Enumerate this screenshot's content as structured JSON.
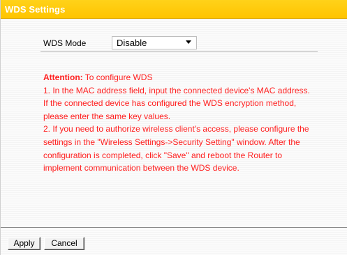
{
  "header": {
    "title": "WDS Settings"
  },
  "wds_mode": {
    "label": "WDS Mode",
    "selected": "Disable"
  },
  "attention": {
    "heading": "Attention:",
    "heading_rest": " To configure WDS",
    "lines": [
      "1. In the MAC address field, input the connected device's MAC address.",
      "If the connected device has configured the WDS encryption method,",
      "please enter the same key values.",
      "2. If you need to authorize wireless client's access, please configure the",
      "settings in the \"Wireless Settings->Security Setting\" window. After the",
      "configuration is completed, click \"Save\" and reboot the Router to",
      "implement communication between the WDS device."
    ]
  },
  "buttons": {
    "apply": "Apply",
    "cancel": "Cancel"
  },
  "colors": {
    "header_bg": "#ffc400",
    "attention_text": "#ff2020"
  }
}
